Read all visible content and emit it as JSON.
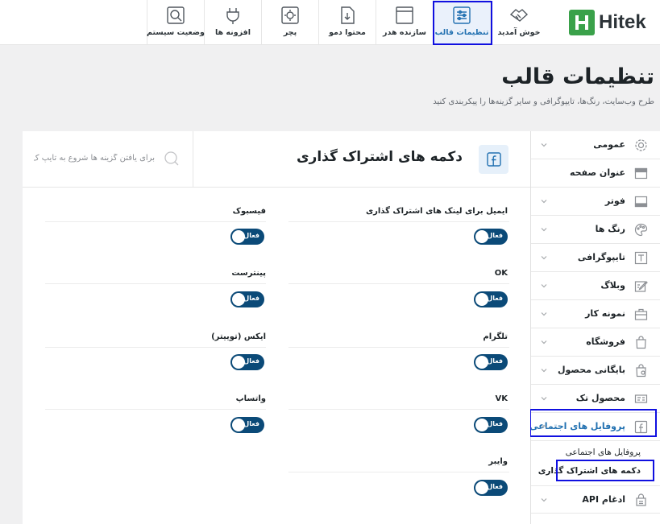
{
  "app": {
    "logo_text": "Hitek"
  },
  "topbar": {
    "tabs": [
      {
        "label": "خوش آمدید",
        "icon": "handshake-icon"
      },
      {
        "label": "تنظیمات قالب",
        "icon": "sliders-icon",
        "active": true
      },
      {
        "label": "سازنده هدر",
        "icon": "header-layout-icon"
      },
      {
        "label": "محتوا دمو",
        "icon": "import-file-icon"
      },
      {
        "label": "پچر",
        "icon": "settings-gear-icon"
      },
      {
        "label": "افزونه ها",
        "icon": "plug-icon"
      },
      {
        "label": "وضعیت سیستم",
        "icon": "system-status-icon"
      }
    ]
  },
  "page": {
    "title": "تنظیمات قالب",
    "subtitle": "طرح وب‌سایت، رنگ‌ها، تایپوگرافی و سایر گزینه‌ها را پیکربندی کنید"
  },
  "sidebar": {
    "items": [
      {
        "label": "عمومی",
        "icon": "gear-icon",
        "has_chevron": true
      },
      {
        "label": "عنوان صفحه",
        "icon": "title-bar-icon",
        "has_chevron": false
      },
      {
        "label": "فوتر",
        "icon": "footer-icon",
        "has_chevron": true
      },
      {
        "label": "رنگ ها",
        "icon": "palette-icon",
        "has_chevron": true
      },
      {
        "label": "تایپوگرافی",
        "icon": "typography-icon",
        "has_chevron": true
      },
      {
        "label": "وبلاگ",
        "icon": "blog-edit-icon",
        "has_chevron": true
      },
      {
        "label": "نمونه کار",
        "icon": "briefcase-icon",
        "has_chevron": true
      },
      {
        "label": "فروشگاه",
        "icon": "shopping-bag-icon",
        "has_chevron": true
      },
      {
        "label": "بایگانی محصول",
        "icon": "archive-icon",
        "has_chevron": true
      },
      {
        "label": "محصول تک",
        "icon": "single-product-icon",
        "has_chevron": true
      },
      {
        "label": "پروفایل های اجتماعی",
        "icon": "facebook-icon",
        "has_chevron": true,
        "active": true
      }
    ],
    "sub_items": [
      {
        "label": "پروفایل های اجتماعی"
      },
      {
        "label": "دکمه های اشتراک گذاری",
        "active": true
      }
    ],
    "last_item": {
      "label": "ادغام API",
      "icon": "api-icon"
    }
  },
  "main": {
    "section_title": "دکمه های اشتراک گذاری",
    "search_placeholder": "برای یافتن گزینه ها شروع به تایپ ک",
    "toggle_on_text": "فعال",
    "fields_right": [
      {
        "label": "ایمیل برای لینک های اشتراک گذاری",
        "enabled": true
      },
      {
        "label": "OK",
        "enabled": true
      },
      {
        "label": "تلگرام",
        "enabled": true
      },
      {
        "label": "VK",
        "enabled": true
      },
      {
        "label": "وایبر",
        "enabled": true
      }
    ],
    "fields_left": [
      {
        "label": "فیسبوک",
        "enabled": true
      },
      {
        "label": "پینترست",
        "enabled": true
      },
      {
        "label": "ایکس (توییتر)",
        "enabled": true
      },
      {
        "label": "واتساپ",
        "enabled": true
      }
    ]
  },
  "colors": {
    "accent": "#2271b1",
    "toggle_on": "#0b4a78",
    "logo_green": "#3aa14a",
    "highlight": "#1010e0"
  }
}
